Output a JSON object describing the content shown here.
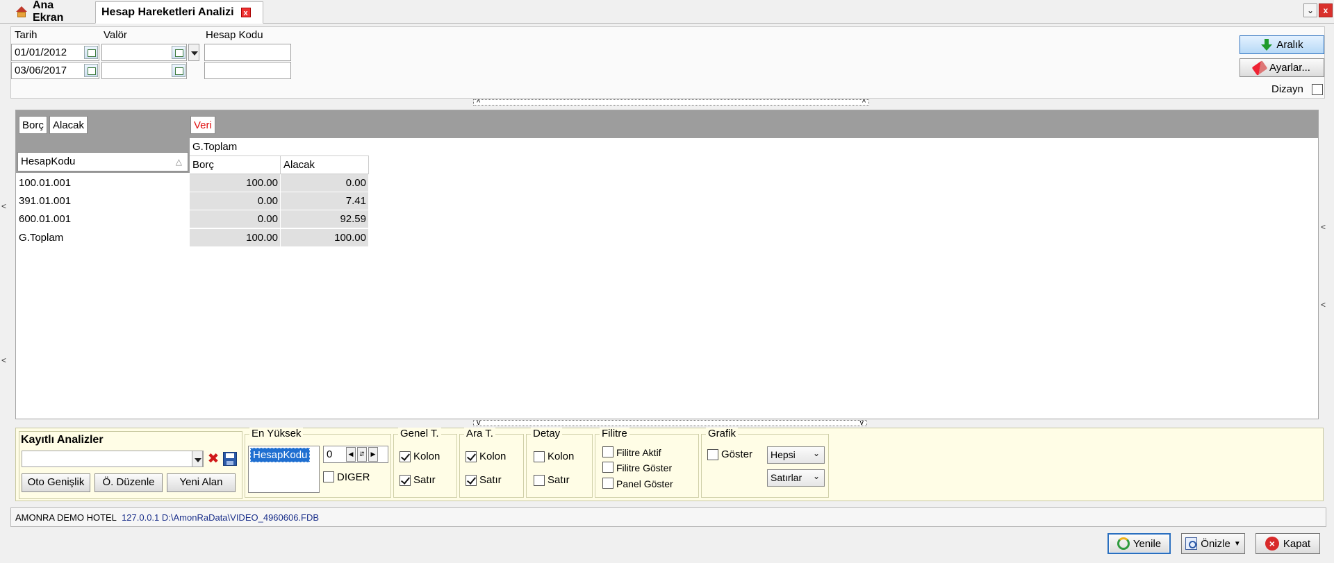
{
  "tabs": {
    "home": "Ana Ekran",
    "active": "Hesap Hareketleri Analizi",
    "close_glyph": "x"
  },
  "filter": {
    "tarih_label": "Tarih",
    "valor_label": "Valör",
    "hesap_kodu_label": "Hesap Kodu",
    "tarih_from": "01/01/2012",
    "tarih_to": "03/06/2017",
    "valor_from": "",
    "valor_to": "",
    "hesap_kodu_from": "",
    "hesap_kodu_to": "",
    "aralik_button": "Aralık",
    "ayarlar_button": "Ayarlar...",
    "dizayn_label": "Dizayn",
    "dizayn_checked": false
  },
  "pivot": {
    "filter_fields": [
      "Borç",
      "Alacak"
    ],
    "data_field": "Veri",
    "row_field": "HesapKodu",
    "column_group": "G.Toplam",
    "columns": [
      "Borç",
      "Alacak"
    ],
    "rows": [
      {
        "label": "100.01.001",
        "borc": "100.00",
        "alacak": "0.00"
      },
      {
        "label": "391.01.001",
        "borc": "0.00",
        "alacak": "7.41"
      },
      {
        "label": "600.01.001",
        "borc": "0.00",
        "alacak": "92.59"
      },
      {
        "label": "G.Toplam",
        "borc": "100.00",
        "alacak": "100.00"
      }
    ]
  },
  "options": {
    "kayitli_title": "Kayıtlı Analizler",
    "kayitli_value": "",
    "oto_genislik": "Oto Genişlik",
    "o_duzenle": "Ö. Düzenle",
    "yeni_alan": "Yeni Alan",
    "en_yuksek_title": "En Yüksek",
    "en_yuksek_list": [
      "HesapKodu"
    ],
    "en_yuksek_value": "0",
    "diger_label": "DIGER",
    "genel_t_title": "Genel T.",
    "ara_t_title": "Ara T.",
    "detay_title": "Detay",
    "kolon": "Kolon",
    "satir": "Satır",
    "filitre_title": "Filitre",
    "filitre_aktif": "Filitre Aktif",
    "filitre_goster": "Filitre Göster",
    "panel_goster": "Panel Göster",
    "grafik_title": "Grafik",
    "goster": "Göster",
    "grafik_select1": "Hepsi",
    "grafik_select2": "Satırlar"
  },
  "status": {
    "hotel": "AMONRA DEMO HOTEL",
    "path": "127.0.0.1 D:\\AmonRaData\\VIDEO_4960606.FDB"
  },
  "bottom": {
    "yenile": "Yenile",
    "onizle": "Önizle",
    "kapat": "Kapat"
  }
}
